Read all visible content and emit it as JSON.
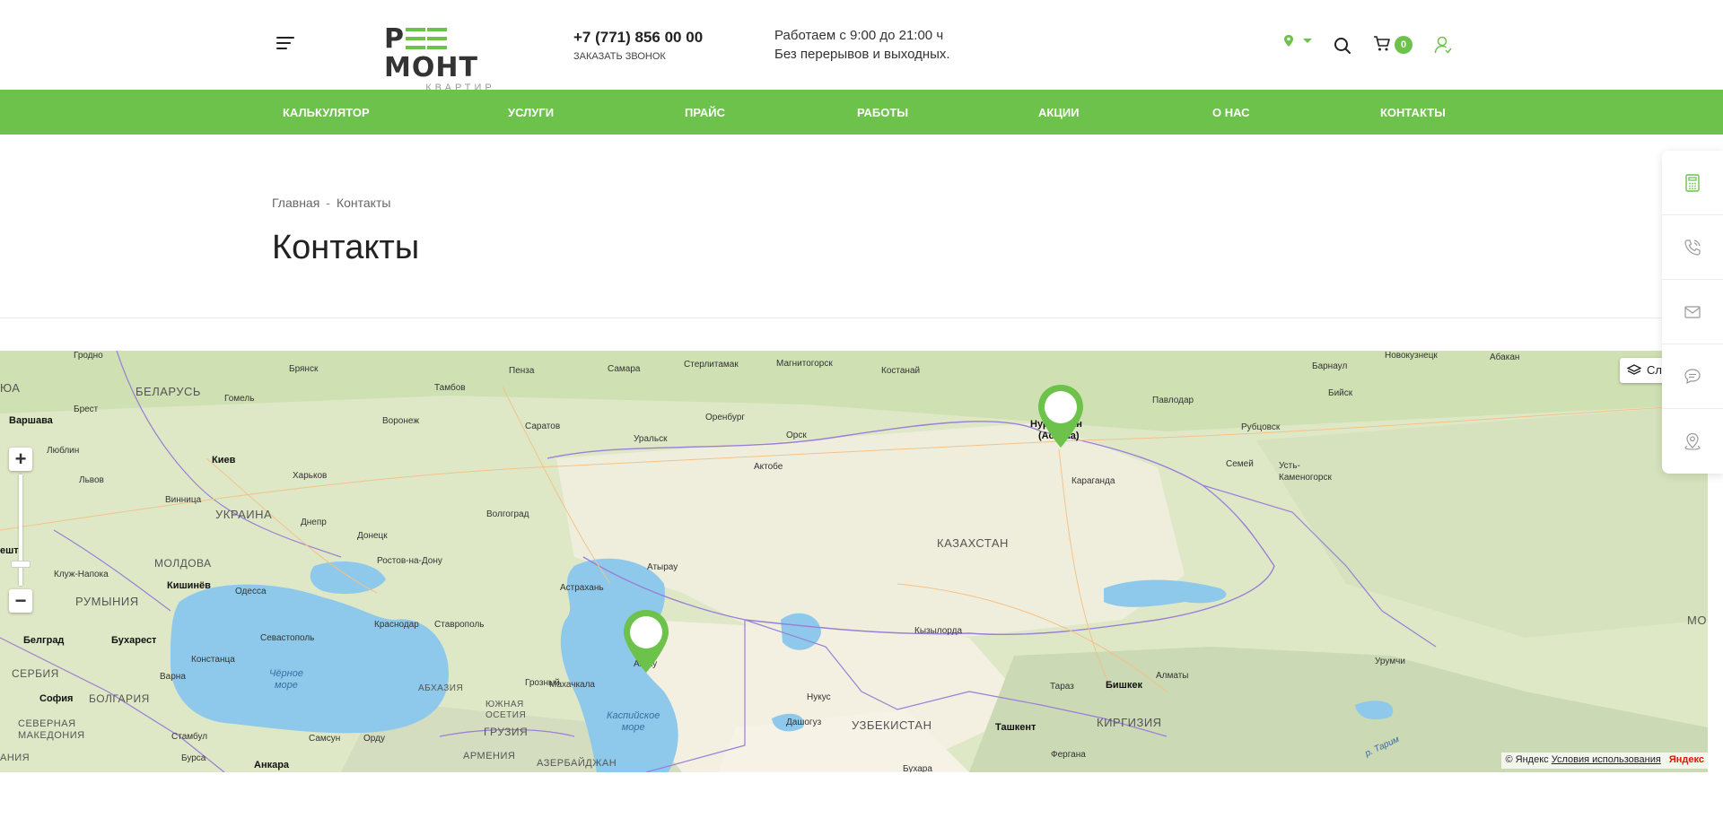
{
  "header": {
    "logo_text": "РЕМОНТ",
    "logo_sub": "КВАРТИР",
    "phone": "+7 (771) 856 00 00",
    "callback_label": "ЗАКАЗАТЬ ЗВОНОК",
    "hours_line1": "Работаем с 9:00 до 21:00 ч",
    "hours_line2": "Без перерывов и выходных.",
    "cart_count": "0"
  },
  "nav": {
    "items": [
      "КАЛЬКУЛЯТОР",
      "УСЛУГИ",
      "ПРАЙС",
      "РАБОТЫ",
      "АКЦИИ",
      "О НАС",
      "КОНТАКТЫ"
    ]
  },
  "breadcrumb": {
    "home": "Главная",
    "separator": "-",
    "current": "Контакты"
  },
  "page": {
    "title": "Контакты"
  },
  "map": {
    "layers_label": "Сл",
    "zoom_in": "+",
    "zoom_out": "−",
    "copyright": "© Яндекс",
    "terms_link": "Условия использования",
    "provider": "Яндекс",
    "countries": {
      "belarus": "БЕЛАРУСЬ",
      "ukraine": "УКРАИНА",
      "moldova": "МОЛДОВА",
      "romania": "РУМЫНИЯ",
      "serbia": "СЕРБИЯ",
      "bulgaria": "БОЛГАРИЯ",
      "n_macedonia": "СЕВЕРНАЯ\nМАКЕДОНИЯ",
      "albania": "АНИЯ",
      "kazakhstan": "КАЗАХСТАН",
      "uzbekistan": "УЗБЕКИСТАН",
      "kyrgyzstan": "КИРГИЗИЯ",
      "georgia": "ГРУЗИЯ",
      "armenia": "АРМЕНИЯ",
      "azerbaijan": "АЗЕРБАЙДЖАН",
      "abkhazia": "АБХАЗИЯ",
      "s_ossetia": "ЮЖНАЯ\nОСЕТИЯ",
      "mongolia": "МО",
      "ukr": "ЮА"
    },
    "seas": {
      "black": "Чёрное\nморе",
      "caspian": "Каспийское\nморе"
    },
    "capitals": {
      "warsaw": "Варшава",
      "kiev": "Киев",
      "chisinau": "Кишинёв",
      "bucharest": "Бухарест",
      "belgrade": "Белград",
      "sofia": "София",
      "ankara": "Анкара",
      "bishkek": "Бишкек",
      "tashkent": "Ташкент",
      "budapest": "ешт",
      "astana_top": "Нурсултан",
      "astana_bottom": "(Астана)"
    },
    "cities": {
      "grodno": "Гродно",
      "bryansk": "Брянск",
      "penza": "Пенза",
      "samara": "Самара",
      "sterlitamak": "Стерлитамак",
      "magnitogorsk": "Магнитогорск",
      "kostanay": "Костанай",
      "barnaul": "Барнаул",
      "novokuznetsk": "Новокузнецк",
      "abakan": "Абакан",
      "gomel": "Гомель",
      "tambov": "Тамбов",
      "brest": "Брест",
      "voronezh": "Воронеж",
      "saratov": "Саратов",
      "orenburg": "Оренбург",
      "pavlodar": "Павлодар",
      "biysk": "Бийск",
      "lublin": "Люблин",
      "uralsk": "Уральск",
      "orsk": "Орск",
      "rubtsovsk": "Рубцовск",
      "kharkov": "Харьков",
      "aktobe": "Актобе",
      "semey": "Семей",
      "ust_kam": "Усть-\nКаменогорск",
      "lvov": "Львов",
      "karaganda": "Караганда",
      "vinnitsa": "Винница",
      "volgograd": "Волгоград",
      "dnepr": "Днепр",
      "donetsk": "Донецк",
      "atyrau": "Атырау",
      "rostov": "Ростов-на-Дону",
      "cluj": "Клуж-Напока",
      "odessa": "Одесса",
      "astrakhan": "Астрахань",
      "krasnodar": "Краснодар",
      "stavropol": "Ставрополь",
      "kyzylorda": "Кызылорда",
      "sevastopol": "Севастополь",
      "constanta": "Констанца",
      "urumqi": "Урумчи",
      "varna": "Варна",
      "grozny": "Грозный",
      "makhachkala": "Махачкала",
      "taraz": "Тараз",
      "almaty": "Алматы",
      "nukus": "Нукус",
      "dashoguz": "Дашогуз",
      "samsun": "Самсун",
      "ordu": "Орду",
      "fergana": "Фергана",
      "istanbul": "Стамбул",
      "bursa": "Бурса",
      "bukhara": "Бухара",
      "aktau": "Актау",
      "tarim": "р. Тарим"
    }
  },
  "side_panel": {
    "items": [
      "calculator-icon",
      "phone-icon",
      "mail-icon",
      "chat-icon",
      "location-icon"
    ]
  },
  "colors": {
    "accent": "#6cc24a",
    "text": "#222222",
    "water": "#8ec9ec"
  }
}
